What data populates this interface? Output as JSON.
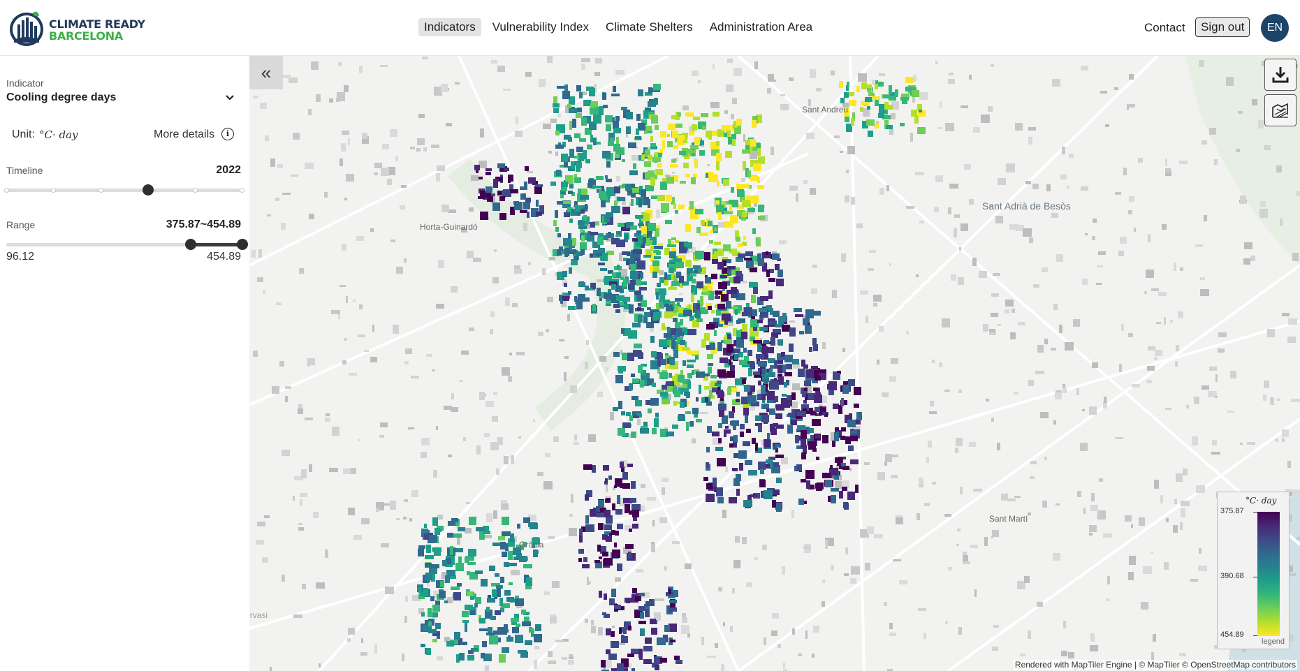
{
  "header": {
    "logo_line1": "CLIMATE READY",
    "logo_line2": "BARCELONA",
    "nav": [
      "Indicators",
      "Vulnerability Index",
      "Climate Shelters",
      "Administration Area"
    ],
    "active_nav": "Indicators",
    "contact": "Contact",
    "sign_out": "Sign out",
    "language": "EN"
  },
  "sidebar": {
    "indicator_label": "Indicator",
    "indicator_value": "Cooling degree days",
    "unit_label": "Unit:",
    "unit_value": "°C· day",
    "more_details": "More details",
    "info_glyph": "i",
    "timeline_label": "Timeline",
    "timeline_value": "2022",
    "timeline_position_fraction": 0.6,
    "range_label": "Range",
    "range_value": "375.87~454.89",
    "range_min": "96.12",
    "range_max": "454.89",
    "range_low": 375.87,
    "range_high": 454.89
  },
  "map": {
    "collapse_glyph": "«",
    "places": [
      "Sant Andreu",
      "Sant Adrià de Besòs",
      "Horta-Guinardó",
      "Sant Martí",
      "Gràcia",
      "Sarrià - Sant Gervasi"
    ],
    "legend": {
      "unit": "°C· day",
      "values": [
        "375.87",
        "390.68",
        "454.89"
      ],
      "footer": "legend",
      "colors": [
        "#440154",
        "#3e4989",
        "#26828e",
        "#35b779",
        "#fde725"
      ]
    },
    "attribution": "Rendered with MapTiler Engine | © MapTiler © OpenStreetMap contributors",
    "icons": [
      "download-icon",
      "map-layers-icon"
    ]
  }
}
